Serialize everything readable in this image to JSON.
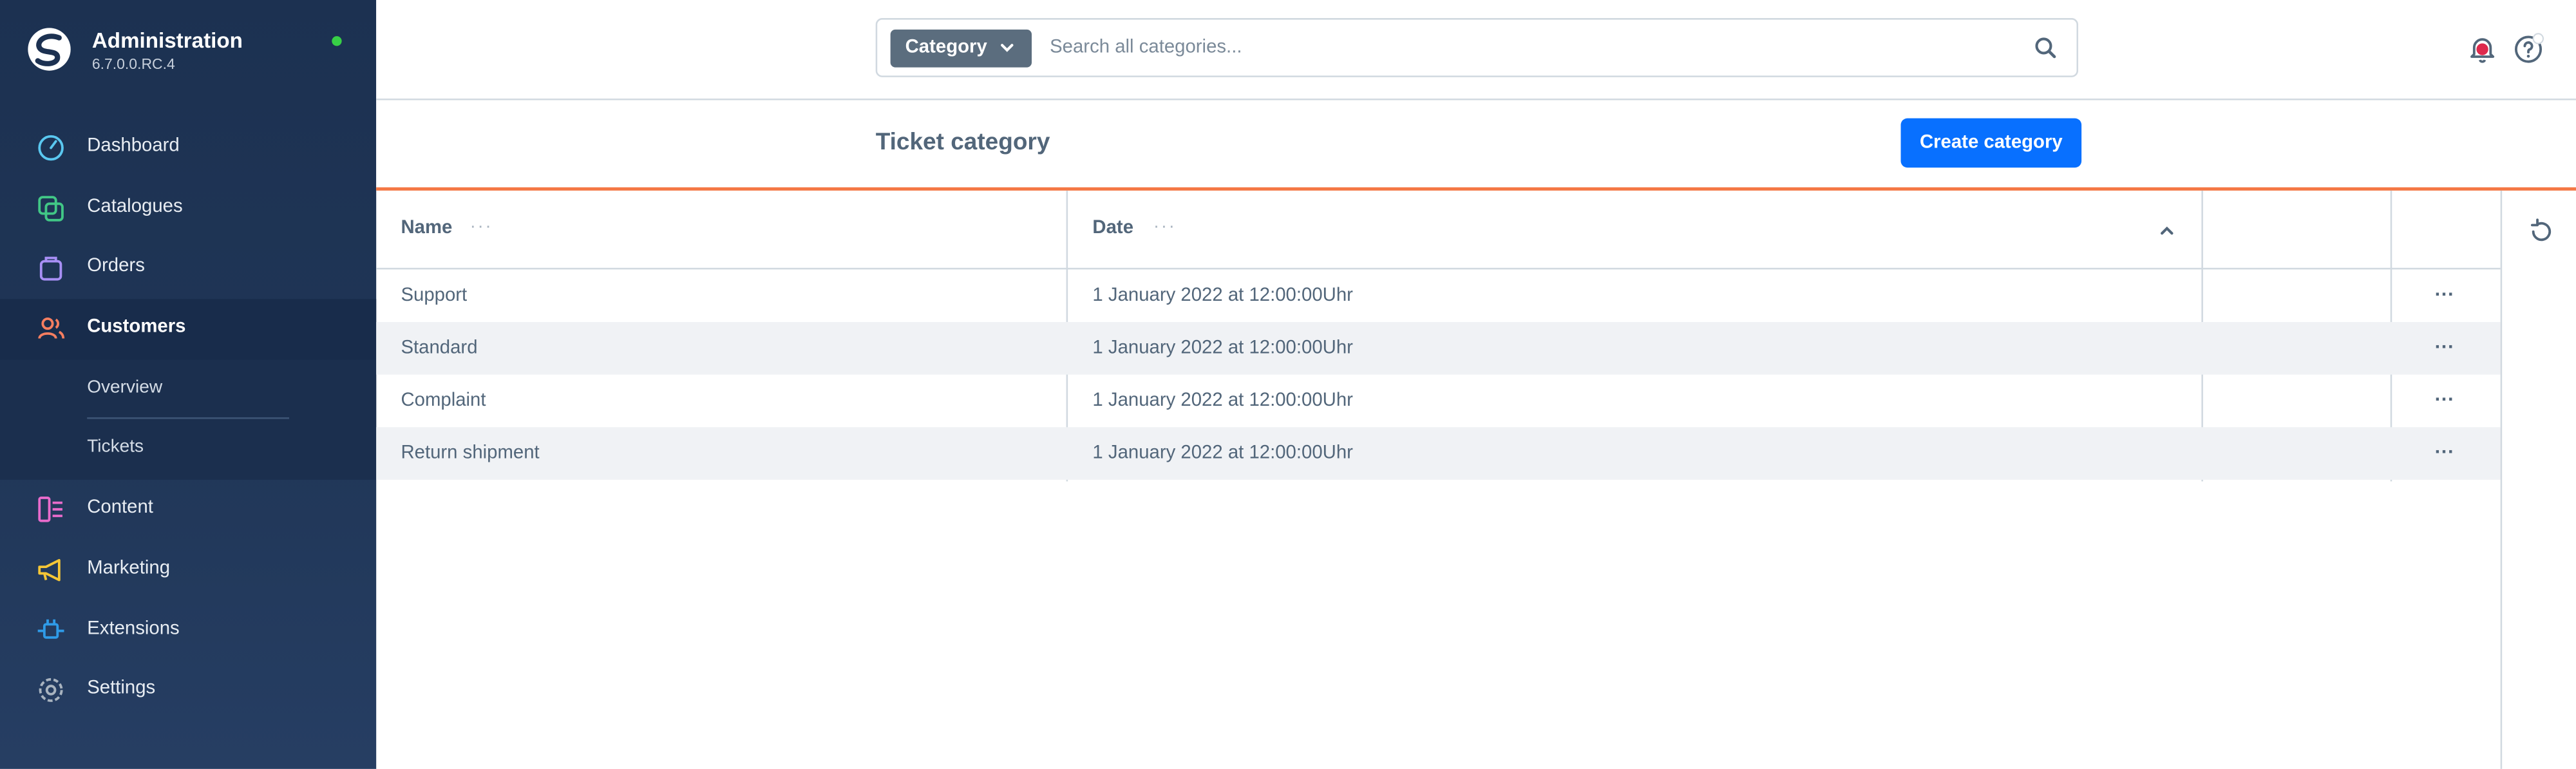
{
  "app": {
    "title": "Administration",
    "version": "6.7.0.0.RC.4",
    "status_color": "#37d046"
  },
  "sidebar": {
    "items": [
      {
        "label": "Dashboard",
        "icon": "dashboard-icon",
        "color": "#5ac8f0"
      },
      {
        "label": "Catalogues",
        "icon": "catalogues-icon",
        "color": "#41c786"
      },
      {
        "label": "Orders",
        "icon": "orders-icon",
        "color": "#a88ff5"
      },
      {
        "label": "Customers",
        "icon": "customers-icon",
        "color": "#f57e60"
      },
      {
        "label": "Content",
        "icon": "content-icon",
        "color": "#e86bcb"
      },
      {
        "label": "Marketing",
        "icon": "marketing-icon",
        "color": "#f5c636"
      },
      {
        "label": "Extensions",
        "icon": "extensions-icon",
        "color": "#2f9be8"
      },
      {
        "label": "Settings",
        "icon": "settings-icon",
        "color": "#a8b3bf"
      }
    ],
    "customers_sub": [
      {
        "label": "Overview"
      },
      {
        "label": "Tickets"
      }
    ]
  },
  "search": {
    "type_label": "Category",
    "placeholder": "Search all categories..."
  },
  "page": {
    "title": "Ticket category",
    "create_label": "Create category",
    "accent": "#f47845",
    "primary": "#0870ff"
  },
  "grid": {
    "columns": [
      "Name",
      "Date"
    ],
    "rows": [
      {
        "name": "Support",
        "date": "1 January 2022 at 12:00:00Uhr"
      },
      {
        "name": "Standard",
        "date": "1 January 2022 at 12:00:00Uhr"
      },
      {
        "name": "Complaint",
        "date": "1 January 2022 at 12:00:00Uhr"
      },
      {
        "name": "Return shipment",
        "date": "1 January 2022 at 12:00:00Uhr"
      }
    ],
    "row_action_glyph": "···"
  }
}
